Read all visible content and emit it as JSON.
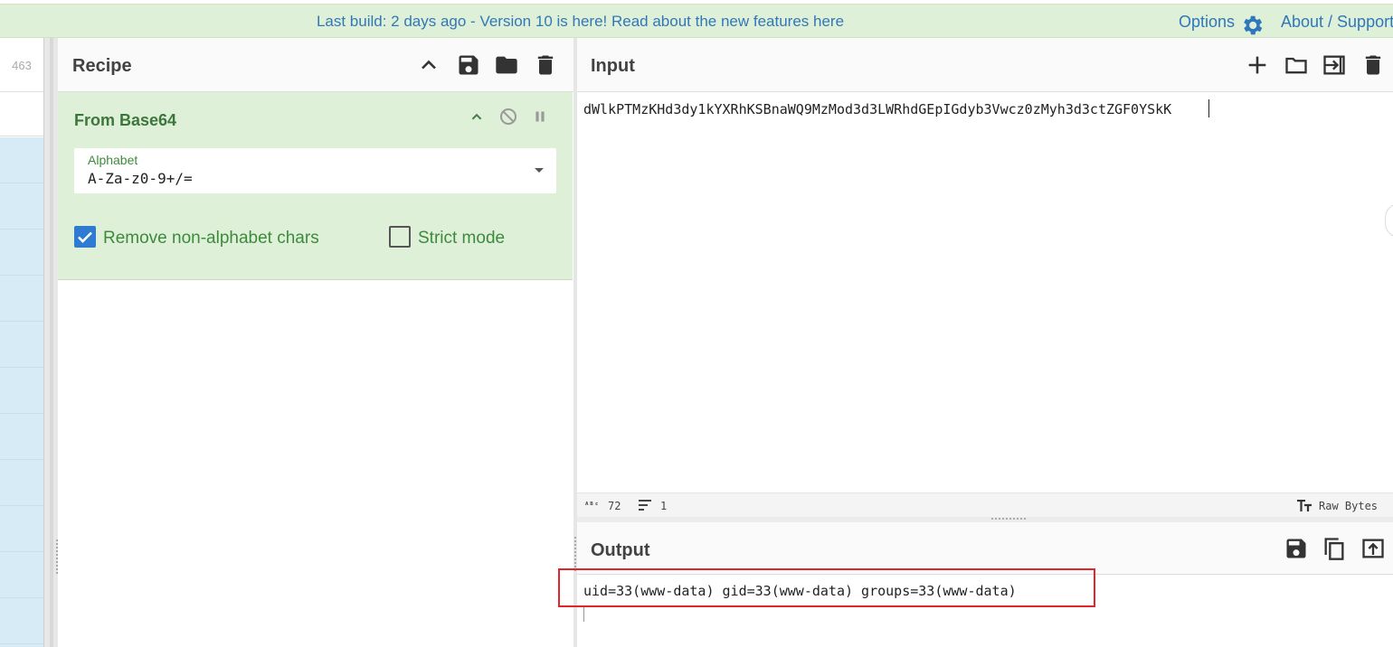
{
  "banner": {
    "message": "Last build: 2 days ago - Version 10 is here! Read about the new features here",
    "options_label": "Options",
    "about_label": "About / Support"
  },
  "operations": {
    "count": "463"
  },
  "recipe": {
    "title": "Recipe",
    "operation": {
      "title": "From Base64",
      "alphabet_label": "Alphabet",
      "alphabet_value": "A-Za-z0-9+/=",
      "remove_nonalpha_label": "Remove non-alphabet chars",
      "remove_nonalpha_checked": true,
      "strict_mode_label": "Strict mode",
      "strict_mode_checked": false
    }
  },
  "input": {
    "title": "Input",
    "text": "dWlkPTMzKHd3dy1kYXRhKSBnaWQ9MzMod3d3LWRhdGEpIGdyb3Vwcz0zMyh3d3ctZGF0YSkK",
    "char_count": "72",
    "line_count": "1",
    "encoding_label": "Raw Bytes"
  },
  "output": {
    "title": "Output",
    "text": "uid=33(www-data) gid=33(www-data) groups=33(www-data)"
  },
  "colors": {
    "banner_bg": "#dff0d8",
    "operation_bg": "#dff0d8",
    "link": "#3277b7",
    "checkbox": "#2e7bd1",
    "highlight_box": "#e0262a"
  },
  "icons": [
    "gear-icon",
    "chevron-up-icon",
    "save-icon",
    "folder-icon",
    "trash-icon",
    "disable-icon",
    "pause-icon",
    "plus-icon",
    "switch-io-icon",
    "copy-icon",
    "replace-input-icon",
    "text-size-icon",
    "lines-icon"
  ]
}
